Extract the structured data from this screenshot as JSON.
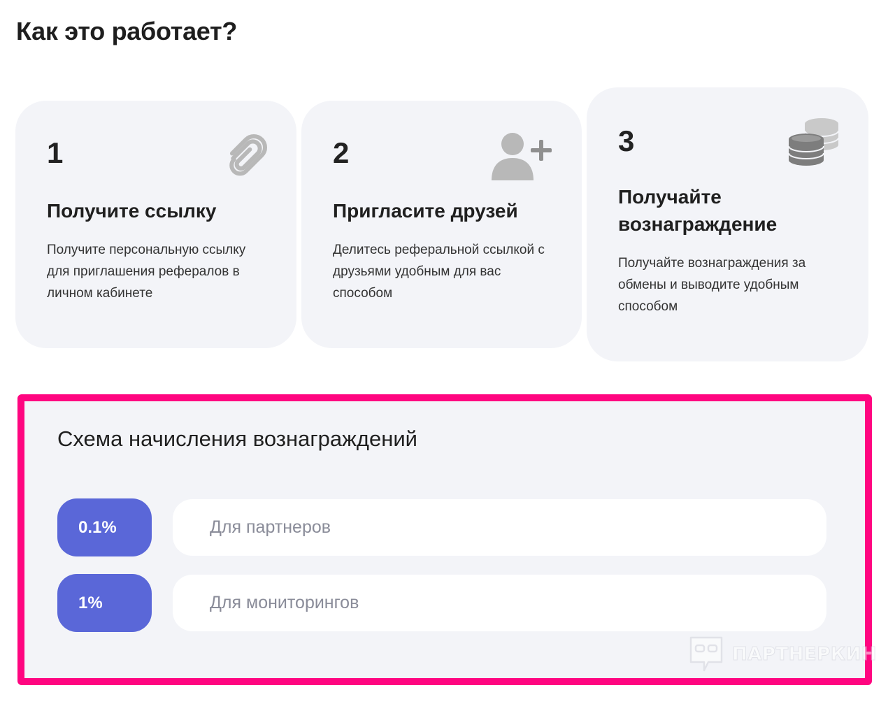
{
  "page": {
    "title": "Как это работает?"
  },
  "steps": [
    {
      "number": "1",
      "title": "Получите ссылку",
      "text": "Получите персональную ссылку для приглашения рефералов в личном кабинете",
      "icon": "paperclip-icon"
    },
    {
      "number": "2",
      "title": "Пригласите друзей",
      "text": "Делитесь реферальной ссылкой с друзьями удобным для вас способом",
      "icon": "add-user-icon"
    },
    {
      "number": "3",
      "title": "Получайте вознаграждение",
      "text": "Получайте вознаграждения за обмены и выводите удобным способом",
      "icon": "coins-icon"
    }
  ],
  "scheme": {
    "title": "Схема начисления вознаграждений",
    "rates": [
      {
        "value": "0.1%",
        "label": "Для партнеров"
      },
      {
        "value": "1%",
        "label": "Для мониторингов"
      }
    ]
  },
  "watermark": {
    "text": "ПАРТНЕРКИН"
  },
  "colors": {
    "card_background": "#f3f4f8",
    "badge": "#5a67d8",
    "highlight_border": "#ff0580",
    "icon_gray": "#b8b8b8"
  }
}
